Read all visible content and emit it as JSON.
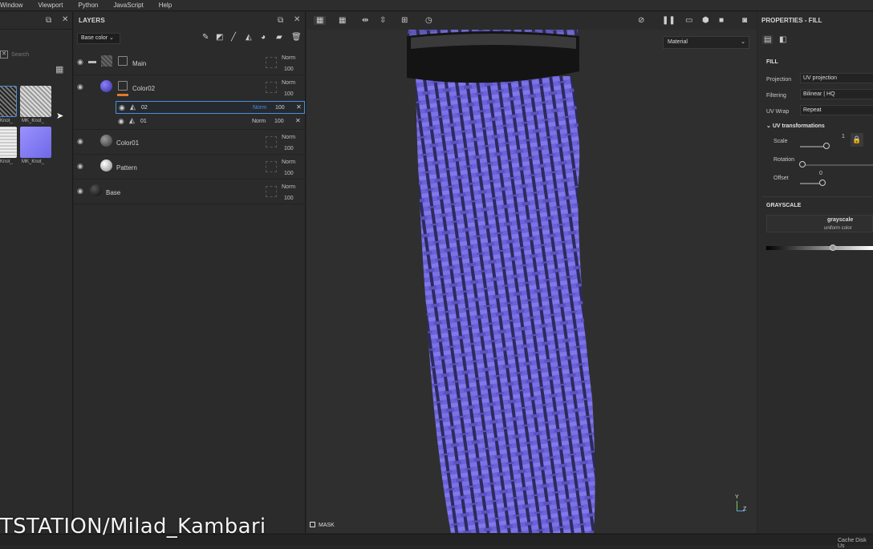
{
  "menu": [
    "Window",
    "Viewport",
    "Python",
    "JavaScript",
    "Help"
  ],
  "shelf": {
    "search_placeholder": "Search",
    "thumbs": [
      {
        "label": "Knot_"
      },
      {
        "label": "MK_Knot_"
      },
      {
        "label": "Knot_"
      },
      {
        "label": "MK_Knot_"
      }
    ]
  },
  "layers": {
    "title": "LAYERS",
    "channel": "Base color",
    "rows": [
      {
        "name": "Main",
        "blend": "Norm",
        "opacity": "100"
      },
      {
        "name": "Color02",
        "blend": "Norm",
        "opacity": "100"
      },
      {
        "name": "02",
        "blend": "Norm",
        "opacity": "100"
      },
      {
        "name": "01",
        "blend": "Norm",
        "opacity": "100"
      },
      {
        "name": "Color01",
        "blend": "Norm",
        "opacity": "100"
      },
      {
        "name": "Pattern",
        "blend": "Norm",
        "opacity": "100"
      },
      {
        "name": "Base",
        "blend": "Norm",
        "opacity": "100"
      }
    ]
  },
  "viewport": {
    "mode": "Material",
    "mask_label": "MASK",
    "axes": {
      "y": "Y",
      "z": "Z"
    }
  },
  "properties": {
    "title": "PROPERTIES - FILL",
    "section": "FILL",
    "projection_label": "Projection",
    "projection": "UV projection",
    "filtering_label": "Filtering",
    "filtering": "Bilinear | HQ",
    "uvwrap_label": "UV Wrap",
    "uvwrap": "Repeat",
    "uvtrans": "UV transformations",
    "scale_label": "Scale",
    "scale_val": "1",
    "rotation_label": "Rotation",
    "offset_label": "Offset",
    "offset_val": "0",
    "grayscale_section": "GRAYSCALE",
    "grayscale_name": "grayscale",
    "grayscale_sub": "uniform color"
  },
  "status": "Cache Disk Us",
  "watermark": "TSTATION/Milad_Kambari",
  "colors": {
    "accent": "#4a8fd6",
    "mesh": "#6b62d8",
    "bg": "#2f2f2f"
  }
}
